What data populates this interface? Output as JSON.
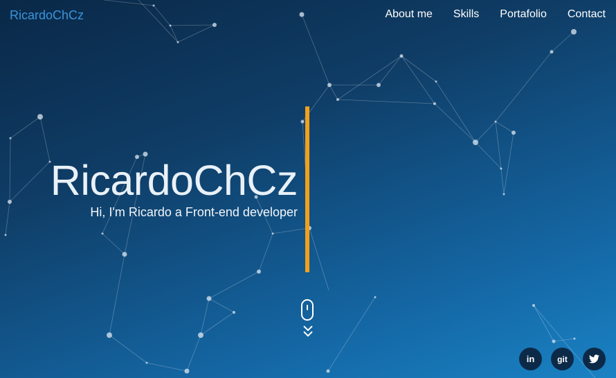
{
  "brand": {
    "logo": "RicardoChCz",
    "accent_color": "#f2a01a",
    "logo_color": "#3a95db"
  },
  "nav": {
    "items": [
      "About me",
      "Skills",
      "Portafolio",
      "Contact"
    ]
  },
  "hero": {
    "title": "RicardoChCz",
    "subtitle": "Hi, I'm Ricardo a Front-end developer"
  },
  "scroll": {
    "icon": "mouse-scroll-icon"
  },
  "social": [
    {
      "label": "in",
      "icon": "linkedin-icon"
    },
    {
      "label": "git",
      "icon": "git-icon"
    },
    {
      "label": "",
      "icon": "twitter-bird-icon"
    }
  ]
}
